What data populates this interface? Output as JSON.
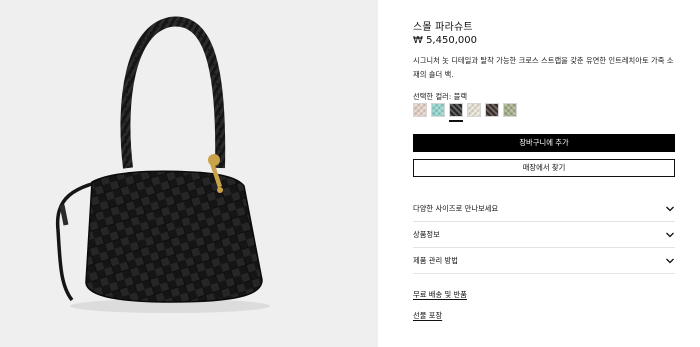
{
  "product": {
    "title": "스몰 파라슈트",
    "price": "₩ 5,450,000",
    "description": "시그니처 놋 디테일과 탈착 가능한 크로스 스트랩을 갖춘 유연한 인트레치아토 가죽 소재의 숄더 백."
  },
  "colors": {
    "label": "선택한 컬러: 블랙",
    "selected_index": 2,
    "swatches": [
      {
        "name": "pink-beige",
        "color": "#e6d2c6"
      },
      {
        "name": "mint",
        "color": "#8fd6cc"
      },
      {
        "name": "black",
        "color": "#2a2a2a"
      },
      {
        "name": "cream",
        "color": "#e9e4d6"
      },
      {
        "name": "dark-brown",
        "color": "#3b2e2a"
      },
      {
        "name": "olive",
        "color": "#a3ad86"
      }
    ]
  },
  "actions": {
    "add_to_cart": "장바구니에 추가",
    "find_in_store": "매장에서 찾기"
  },
  "accordion": [
    {
      "label": "다양한 사이즈로 만나보세요"
    },
    {
      "label": "상품정보"
    },
    {
      "label": "제품 관리 방법"
    }
  ],
  "links": {
    "shipping": "무료 배송 및 반품",
    "gift": "선물 포장"
  },
  "theme": {
    "image_bg": "#efefef",
    "primary": "#000000"
  }
}
